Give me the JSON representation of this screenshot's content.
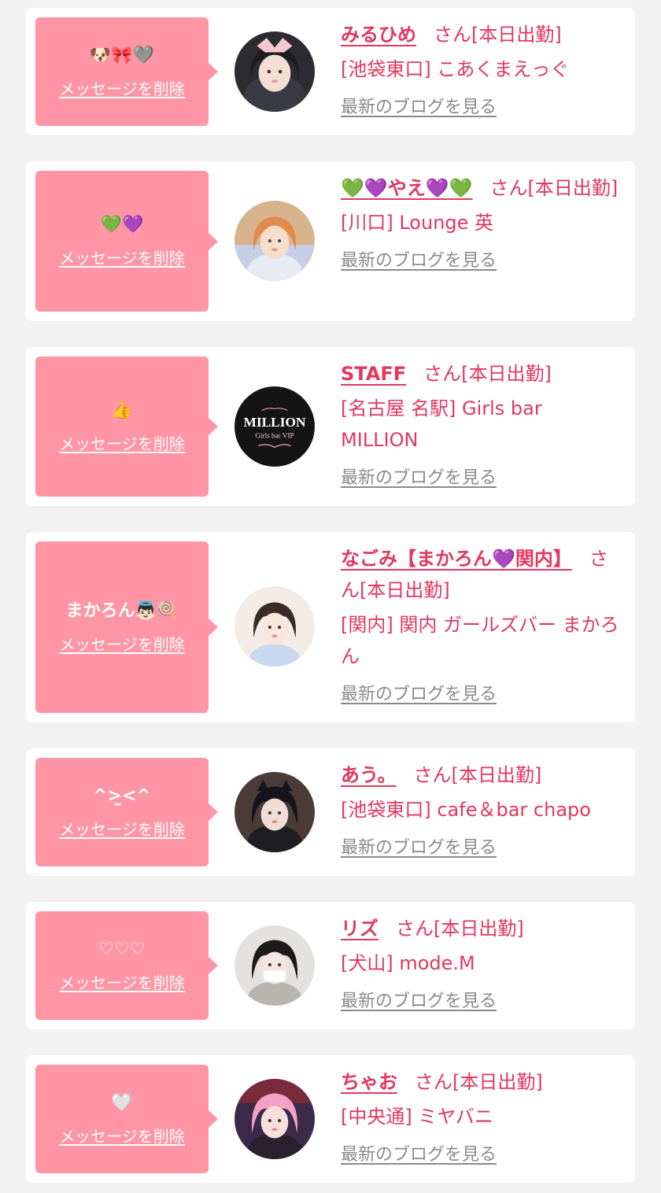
{
  "delete_label": "メッセージを削除",
  "blog_label": "最新のブログを見る",
  "colors": {
    "accent": "#e2375e",
    "box": "#ff95a5",
    "link_gray": "#8a8a8a",
    "bg": "#f2f2f2"
  },
  "items": [
    {
      "message": "🐶🎀🩶",
      "name": "みるひめ",
      "status": "さん[本日出勤]",
      "shop": "[池袋東口] こあくまえっぐ",
      "avatar": "girl-photo"
    },
    {
      "message": "💚💜",
      "name": "💚💜やえ💜💚",
      "status": "さん[本日出勤]",
      "shop": "[川口] Lounge 英",
      "avatar": "girl-photo"
    },
    {
      "message": "👍",
      "name": "STAFF",
      "status": "さん[本日出勤]",
      "shop": "[名古屋 名駅] Girls bar MILLION",
      "avatar": "million-logo",
      "logo_text": "MILLION",
      "logo_sub": "Girls bar VIP"
    },
    {
      "message": "まかろん👼🏻🍭",
      "name": "なごみ【まかろん💜関内】",
      "status": "さん[本日出勤]",
      "shop": "[関内] 関内 ガールズバー まかろん",
      "avatar": "girl-photo"
    },
    {
      "message": "^>̫<^",
      "name": "あう。",
      "status": "さん[本日出勤]",
      "shop": "[池袋東口] cafe＆bar chapo",
      "avatar": "girl-photo"
    },
    {
      "message": "♡♡♡",
      "name": "リズ",
      "status": "さん[本日出勤]",
      "shop": "[犬山] mode.M",
      "avatar": "girl-photo"
    },
    {
      "message": "🤍",
      "name": "ちゃお",
      "status": "さん[本日出勤]",
      "shop": "[中央通] ミヤバニ",
      "avatar": "girl-photo"
    }
  ]
}
